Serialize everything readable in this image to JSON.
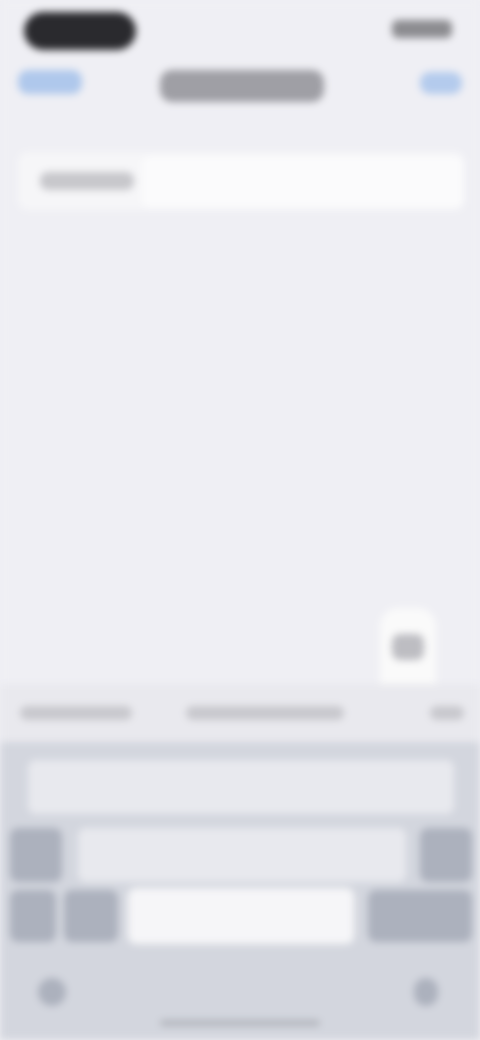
{
  "screen": {
    "note_blurred": "",
    "status": {
      "time": "",
      "battery": ""
    },
    "nav": {
      "back_label": "",
      "title": "",
      "action_label": ""
    },
    "form": {
      "label": "",
      "value": "",
      "placeholder": ""
    },
    "keyboard": {
      "predictions": [
        "",
        "",
        ""
      ],
      "row1_keys": [
        "",
        "",
        "",
        "",
        "",
        "",
        "",
        "",
        "",
        ""
      ],
      "row2_keys": [
        "",
        "",
        "",
        "",
        "",
        "",
        "",
        "",
        ""
      ],
      "row3_keys": [
        "",
        "",
        "",
        "",
        "",
        "",
        ""
      ],
      "bottom_keys": [
        "",
        "",
        "",
        ""
      ]
    },
    "colors": {
      "background": "#efeff4",
      "accent": "#7aa7e6",
      "keyboard": "#d3d6de"
    }
  }
}
